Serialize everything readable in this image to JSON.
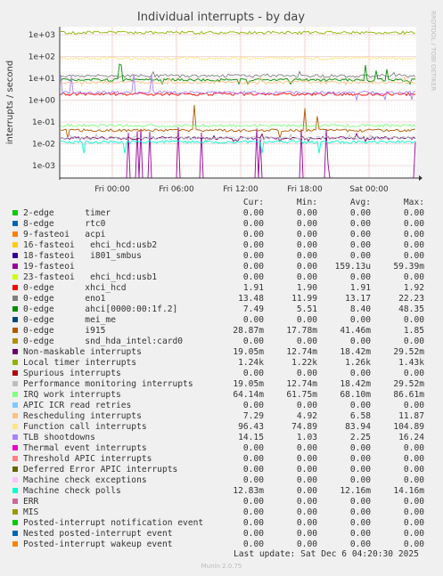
{
  "chart_data": {
    "type": "line",
    "title": "Individual interrupts - by day",
    "ylabel": "interrupts / second",
    "yscale": "log",
    "ylim": [
      0.0005,
      1500
    ],
    "y_ticks": [
      "1e+03",
      "1e+02",
      "1e+01",
      "1e+00",
      "1e-01",
      "1e-02",
      "1e-03"
    ],
    "x_ticks": [
      "Fri 00:00",
      "Fri 06:00",
      "Fri 12:00",
      "Fri 18:00",
      "Sat 00:00"
    ],
    "columns": [
      "Cur:",
      "Min:",
      "Avg:",
      "Max:"
    ],
    "series": [
      {
        "name": "2-edge      timer",
        "color": "#00cc00",
        "cur": "0.00",
        "min": "0.00",
        "avg": "0.00",
        "max": "0.00"
      },
      {
        "name": "8-edge      rtc0",
        "color": "#0066b3",
        "cur": "0.00",
        "min": "0.00",
        "avg": "0.00",
        "max": "0.00"
      },
      {
        "name": "9-fasteoi   acpi",
        "color": "#ff8000",
        "cur": "0.00",
        "min": "0.00",
        "avg": "0.00",
        "max": "0.00"
      },
      {
        "name": "16-fasteoi   ehci_hcd:usb2",
        "color": "#ffcc00",
        "cur": "0.00",
        "min": "0.00",
        "avg": "0.00",
        "max": "0.00"
      },
      {
        "name": "18-fasteoi   i801_smbus",
        "color": "#330099",
        "cur": "0.00",
        "min": "0.00",
        "avg": "0.00",
        "max": "0.00"
      },
      {
        "name": "19-fasteoi",
        "color": "#990099",
        "cur": "0.00",
        "min": "0.00",
        "avg": "159.13u",
        "max": "59.39m"
      },
      {
        "name": "23-fasteoi   ehci_hcd:usb1",
        "color": "#ccff00",
        "cur": "0.00",
        "min": "0.00",
        "avg": "0.00",
        "max": "0.00"
      },
      {
        "name": "0-edge      xhci_hcd",
        "color": "#ff0000",
        "cur": "1.91",
        "min": "1.90",
        "avg": "1.91",
        "max": "1.92"
      },
      {
        "name": "0-edge      eno1",
        "color": "#808080",
        "cur": "13.48",
        "min": "11.99",
        "avg": "13.17",
        "max": "22.23"
      },
      {
        "name": "0-edge      ahci[0000:00:1f.2]",
        "color": "#008f00",
        "cur": "7.49",
        "min": "5.51",
        "avg": "8.40",
        "max": "48.35"
      },
      {
        "name": "0-edge      mei_me",
        "color": "#00487d",
        "cur": "0.00",
        "min": "0.00",
        "avg": "0.00",
        "max": "0.00"
      },
      {
        "name": "0-edge      i915",
        "color": "#b35a00",
        "cur": "28.87m",
        "min": "17.78m",
        "avg": "41.46m",
        "max": "1.85"
      },
      {
        "name": "0-edge      snd_hda_intel:card0",
        "color": "#b38f00",
        "cur": "0.00",
        "min": "0.00",
        "avg": "0.00",
        "max": "0.00"
      },
      {
        "name": "Non-maskable interrupts",
        "color": "#6b006b",
        "cur": "19.05m",
        "min": "12.74m",
        "avg": "18.42m",
        "max": "29.52m"
      },
      {
        "name": "Local timer interrupts",
        "color": "#8fb300",
        "cur": "1.24k",
        "min": "1.22k",
        "avg": "1.26k",
        "max": "1.43k"
      },
      {
        "name": "Spurious interrupts",
        "color": "#b30000",
        "cur": "0.00",
        "min": "0.00",
        "avg": "0.00",
        "max": "0.00"
      },
      {
        "name": "Performance monitoring interrupts",
        "color": "#bebebe",
        "cur": "19.05m",
        "min": "12.74m",
        "avg": "18.42m",
        "max": "29.52m"
      },
      {
        "name": "IRQ work interrupts",
        "color": "#80ff80",
        "cur": "64.14m",
        "min": "61.75m",
        "avg": "68.10m",
        "max": "86.61m"
      },
      {
        "name": "APIC ICR read retries",
        "color": "#80c9ff",
        "cur": "0.00",
        "min": "0.00",
        "avg": "0.00",
        "max": "0.00"
      },
      {
        "name": "Rescheduling interrupts",
        "color": "#ffc080",
        "cur": "7.29",
        "min": "4.92",
        "avg": "6.58",
        "max": "11.87"
      },
      {
        "name": "Function call interrupts",
        "color": "#ffe680",
        "cur": "96.43",
        "min": "74.89",
        "avg": "83.94",
        "max": "104.89"
      },
      {
        "name": "TLB shootdowns",
        "color": "#aa80ff",
        "cur": "14.15",
        "min": "1.03",
        "avg": "2.25",
        "max": "16.24"
      },
      {
        "name": "Thermal event interrupts",
        "color": "#ee00cc",
        "cur": "0.00",
        "min": "0.00",
        "avg": "0.00",
        "max": "0.00"
      },
      {
        "name": "Threshold APIC interrupts",
        "color": "#ff8080",
        "cur": "0.00",
        "min": "0.00",
        "avg": "0.00",
        "max": "0.00"
      },
      {
        "name": "Deferred Error APIC interrupts",
        "color": "#666600",
        "cur": "0.00",
        "min": "0.00",
        "avg": "0.00",
        "max": "0.00"
      },
      {
        "name": "Machine check exceptions",
        "color": "#ffbfff",
        "cur": "0.00",
        "min": "0.00",
        "avg": "0.00",
        "max": "0.00"
      },
      {
        "name": "Machine check polls",
        "color": "#00ffcc",
        "cur": "12.83m",
        "min": "0.00",
        "avg": "12.16m",
        "max": "14.16m"
      },
      {
        "name": "ERR",
        "color": "#cc6699",
        "cur": "0.00",
        "min": "0.00",
        "avg": "0.00",
        "max": "0.00"
      },
      {
        "name": "MIS",
        "color": "#999900",
        "cur": "0.00",
        "min": "0.00",
        "avg": "0.00",
        "max": "0.00"
      },
      {
        "name": "Posted-interrupt notification event",
        "color": "#00cc00",
        "cur": "0.00",
        "min": "0.00",
        "avg": "0.00",
        "max": "0.00"
      },
      {
        "name": "Nested posted-interrupt event",
        "color": "#0066b3",
        "cur": "0.00",
        "min": "0.00",
        "avg": "0.00",
        "max": "0.00"
      },
      {
        "name": "Posted-interrupt wakeup event",
        "color": "#ff8000",
        "cur": "0.00",
        "min": "0.00",
        "avg": "0.00",
        "max": "0.00"
      }
    ],
    "grid": true
  },
  "side_label": "RRDTOOL / TOBI OETIKER",
  "last_update": "Last update: Sat Dec  6 04:20:30 2025",
  "version": "Munin 2.0.75"
}
